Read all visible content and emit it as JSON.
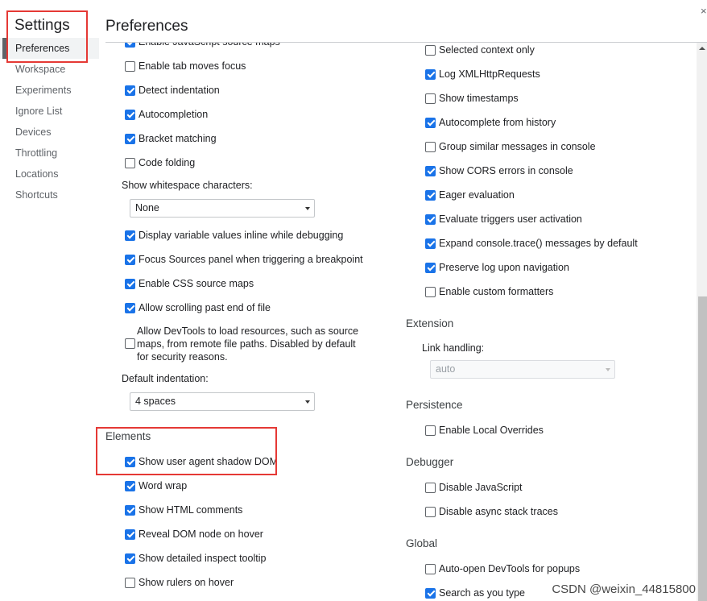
{
  "sidebar": {
    "title": "Settings",
    "items": [
      "Preferences",
      "Workspace",
      "Experiments",
      "Ignore List",
      "Devices",
      "Throttling",
      "Locations",
      "Shortcuts"
    ],
    "selected": "Preferences"
  },
  "header": {
    "title": "Preferences",
    "close": "×"
  },
  "left": {
    "items_top": [
      {
        "label": "Enable JavaScript source maps",
        "checked": true
      },
      {
        "label": "Enable tab moves focus",
        "checked": false
      },
      {
        "label": "Detect indentation",
        "checked": true
      },
      {
        "label": "Autocompletion",
        "checked": true
      },
      {
        "label": "Bracket matching",
        "checked": true
      },
      {
        "label": "Code folding",
        "checked": false
      }
    ],
    "whitespace_label": "Show whitespace characters:",
    "whitespace_value": "None",
    "items_mid": [
      {
        "label": "Display variable values inline while debugging",
        "checked": true
      },
      {
        "label": "Focus Sources panel when triggering a breakpoint",
        "checked": true
      },
      {
        "label": "Enable CSS source maps",
        "checked": true
      },
      {
        "label": "Allow scrolling past end of file",
        "checked": true
      }
    ],
    "remote_files": {
      "lines": [
        "Allow DevTools to load resources, such as source",
        "maps, from remote file paths. Disabled by default",
        "for security reasons."
      ],
      "checked": false
    },
    "indent_label": "Default indentation:",
    "indent_value": "4 spaces",
    "elements_title": "Elements",
    "elements": [
      {
        "label": "Show user agent shadow DOM",
        "checked": true
      },
      {
        "label": "Word wrap",
        "checked": true
      },
      {
        "label": "Show HTML comments",
        "checked": true
      },
      {
        "label": "Reveal DOM node on hover",
        "checked": true
      },
      {
        "label": "Show detailed inspect tooltip",
        "checked": true
      },
      {
        "label": "Show rulers on hover",
        "checked": false
      }
    ]
  },
  "right": {
    "console": [
      {
        "label": "Selected context only",
        "checked": false
      },
      {
        "label": "Log XMLHttpRequests",
        "checked": true
      },
      {
        "label": "Show timestamps",
        "checked": false
      },
      {
        "label": "Autocomplete from history",
        "checked": true
      },
      {
        "label": "Group similar messages in console",
        "checked": false
      },
      {
        "label": "Show CORS errors in console",
        "checked": true
      },
      {
        "label": "Eager evaluation",
        "checked": true
      },
      {
        "label": "Evaluate triggers user activation",
        "checked": true
      },
      {
        "label": "Expand console.trace() messages by default",
        "checked": true
      },
      {
        "label": "Preserve log upon navigation",
        "checked": true
      },
      {
        "label": "Enable custom formatters",
        "checked": false
      }
    ],
    "extension_title": "Extension",
    "link_label": "Link handling:",
    "link_value": "auto",
    "persistence_title": "Persistence",
    "persistence": [
      {
        "label": "Enable Local Overrides",
        "checked": false
      }
    ],
    "debugger_title": "Debugger",
    "debugger": [
      {
        "label": "Disable JavaScript",
        "checked": false
      },
      {
        "label": "Disable async stack traces",
        "checked": false
      }
    ],
    "global_title": "Global",
    "global": [
      {
        "label": "Auto-open DevTools for popups",
        "checked": false
      },
      {
        "label": "Search as you type",
        "checked": true
      }
    ]
  },
  "watermark": "CSDN @weixin_44815800",
  "colors": {
    "accent": "#1a73e8",
    "highlight_box": "#e53935"
  }
}
